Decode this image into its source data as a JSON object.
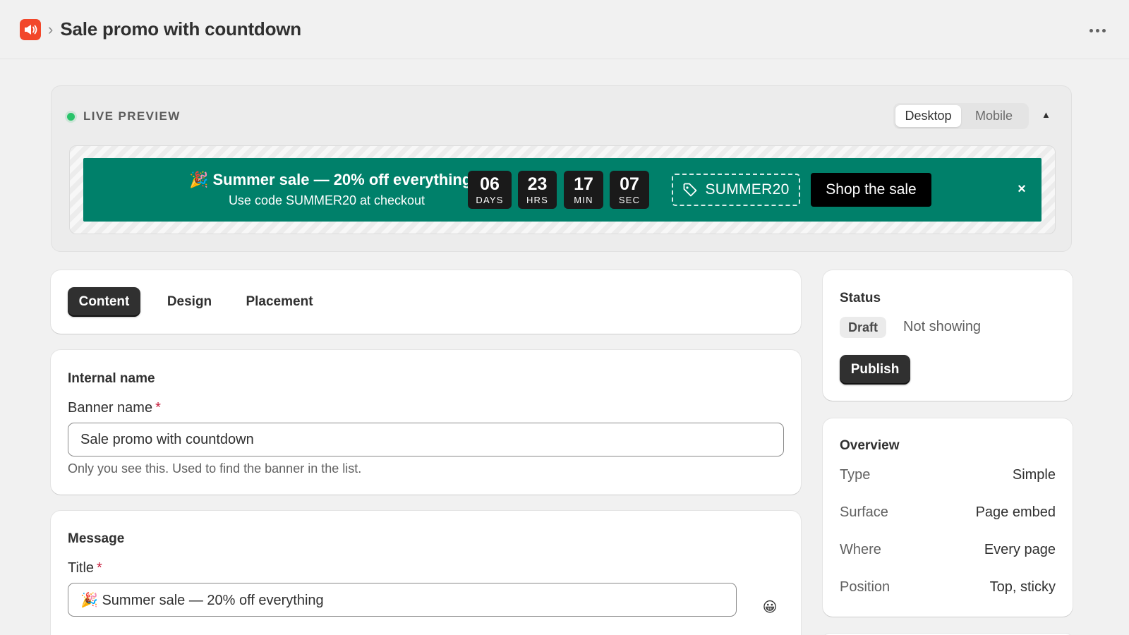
{
  "header": {
    "title": "Sale promo with countdown"
  },
  "preview": {
    "live_label": "LIVE PREVIEW",
    "device_options": [
      "Desktop",
      "Mobile"
    ],
    "selected_device": "Desktop",
    "banner": {
      "background_color": "#00806a",
      "title": "🎉 Summer sale — 20% off everything",
      "subtitle": "Use code SUMMER20 at checkout",
      "countdown": [
        {
          "value": "06",
          "unit": "DAYS"
        },
        {
          "value": "23",
          "unit": "HRS"
        },
        {
          "value": "17",
          "unit": "MIN"
        },
        {
          "value": "07",
          "unit": "SEC"
        }
      ],
      "coupon_code": "SUMMER20",
      "cta_label": "Shop the sale",
      "close_label": "×"
    }
  },
  "tabs": [
    {
      "label": "Content",
      "active": true
    },
    {
      "label": "Design",
      "active": false
    },
    {
      "label": "Placement",
      "active": false
    }
  ],
  "internal_name": {
    "section_title": "Internal name",
    "field_label": "Banner name",
    "required_mark": "*",
    "value": "Sale promo with countdown",
    "help_text": "Only you see this. Used to find the banner in the list."
  },
  "message": {
    "section_title": "Message",
    "title_label": "Title",
    "required_mark": "*",
    "title_value": "🎉 Summer sale — 20% off everything",
    "emoji_button": "😀"
  },
  "status": {
    "title": "Status",
    "badge": "Draft",
    "state_text": "Not showing",
    "publish_label": "Publish"
  },
  "overview": {
    "title": "Overview",
    "rows": [
      {
        "key": "Type",
        "value": "Simple"
      },
      {
        "key": "Surface",
        "value": "Page embed"
      },
      {
        "key": "Where",
        "value": "Every page"
      },
      {
        "key": "Position",
        "value": "Top, sticky"
      }
    ]
  },
  "colors": {
    "app_icon": "#f2472a",
    "live_dot": "#29c36a",
    "primary_button": "#303030",
    "required": "#c7203f"
  }
}
